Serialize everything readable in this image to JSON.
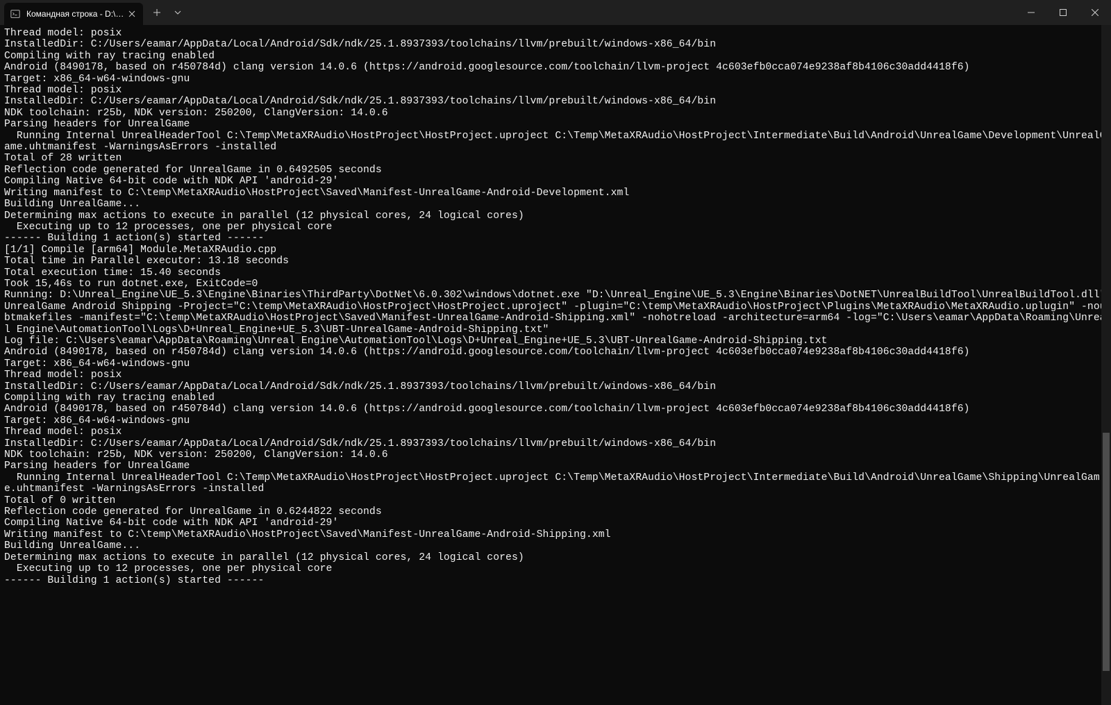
{
  "window": {
    "tab_title": "Командная строка - D:\\Unrea"
  },
  "terminal": {
    "lines": [
      "Thread model: posix",
      "InstalledDir: C:/Users/eamar/AppData/Local/Android/Sdk/ndk/25.1.8937393/toolchains/llvm/prebuilt/windows-x86_64/bin",
      "Compiling with ray tracing enabled",
      "Android (8490178, based on r450784d) clang version 14.0.6 (https://android.googlesource.com/toolchain/llvm-project 4c603efb0cca074e9238af8b4106c30add4418f6)",
      "Target: x86_64-w64-windows-gnu",
      "Thread model: posix",
      "InstalledDir: C:/Users/eamar/AppData/Local/Android/Sdk/ndk/25.1.8937393/toolchains/llvm/prebuilt/windows-x86_64/bin",
      "NDK toolchain: r25b, NDK version: 250200, ClangVersion: 14.0.6",
      "Parsing headers for UnrealGame",
      "  Running Internal UnrealHeaderTool C:\\Temp\\MetaXRAudio\\HostProject\\HostProject.uproject C:\\Temp\\MetaXRAudio\\HostProject\\Intermediate\\Build\\Android\\UnrealGame\\Development\\UnrealGame.uhtmanifest -WarningsAsErrors -installed",
      "Total of 28 written",
      "Reflection code generated for UnrealGame in 0.6492505 seconds",
      "Compiling Native 64-bit code with NDK API 'android-29'",
      "Writing manifest to C:\\temp\\MetaXRAudio\\HostProject\\Saved\\Manifest-UnrealGame-Android-Development.xml",
      "Building UnrealGame...",
      "Determining max actions to execute in parallel (12 physical cores, 24 logical cores)",
      "  Executing up to 12 processes, one per physical core",
      "------ Building 1 action(s) started ------",
      "[1/1] Compile [arm64] Module.MetaXRAudio.cpp",
      "Total time in Parallel executor: 13.18 seconds",
      "Total execution time: 15.40 seconds",
      "Took 15,46s to run dotnet.exe, ExitCode=0",
      "Running: D:\\Unreal_Engine\\UE_5.3\\Engine\\Binaries\\ThirdParty\\DotNet\\6.0.302\\windows\\dotnet.exe \"D:\\Unreal_Engine\\UE_5.3\\Engine\\Binaries\\DotNET\\UnrealBuildTool\\UnrealBuildTool.dll\" UnrealGame Android Shipping -Project=\"C:\\temp\\MetaXRAudio\\HostProject\\HostProject.uproject\" -plugin=\"C:\\temp\\MetaXRAudio\\HostProject\\Plugins\\MetaXRAudio\\MetaXRAudio.uplugin\" -noubtmakefiles -manifest=\"C:\\temp\\MetaXRAudio\\HostProject\\Saved\\Manifest-UnrealGame-Android-Shipping.xml\" -nohotreload -architecture=arm64 -log=\"C:\\Users\\eamar\\AppData\\Roaming\\Unreal Engine\\AutomationTool\\Logs\\D+Unreal_Engine+UE_5.3\\UBT-UnrealGame-Android-Shipping.txt\"",
      "Log file: C:\\Users\\eamar\\AppData\\Roaming\\Unreal Engine\\AutomationTool\\Logs\\D+Unreal_Engine+UE_5.3\\UBT-UnrealGame-Android-Shipping.txt",
      "Android (8490178, based on r450784d) clang version 14.0.6 (https://android.googlesource.com/toolchain/llvm-project 4c603efb0cca074e9238af8b4106c30add4418f6)",
      "Target: x86_64-w64-windows-gnu",
      "Thread model: posix",
      "InstalledDir: C:/Users/eamar/AppData/Local/Android/Sdk/ndk/25.1.8937393/toolchains/llvm/prebuilt/windows-x86_64/bin",
      "Compiling with ray tracing enabled",
      "Android (8490178, based on r450784d) clang version 14.0.6 (https://android.googlesource.com/toolchain/llvm-project 4c603efb0cca074e9238af8b4106c30add4418f6)",
      "Target: x86_64-w64-windows-gnu",
      "Thread model: posix",
      "InstalledDir: C:/Users/eamar/AppData/Local/Android/Sdk/ndk/25.1.8937393/toolchains/llvm/prebuilt/windows-x86_64/bin",
      "NDK toolchain: r25b, NDK version: 250200, ClangVersion: 14.0.6",
      "Parsing headers for UnrealGame",
      "  Running Internal UnrealHeaderTool C:\\Temp\\MetaXRAudio\\HostProject\\HostProject.uproject C:\\Temp\\MetaXRAudio\\HostProject\\Intermediate\\Build\\Android\\UnrealGame\\Shipping\\UnrealGame.uhtmanifest -WarningsAsErrors -installed",
      "Total of 0 written",
      "Reflection code generated for UnrealGame in 0.6244822 seconds",
      "Compiling Native 64-bit code with NDK API 'android-29'",
      "Writing manifest to C:\\temp\\MetaXRAudio\\HostProject\\Saved\\Manifest-UnrealGame-Android-Shipping.xml",
      "Building UnrealGame...",
      "Determining max actions to execute in parallel (12 physical cores, 24 logical cores)",
      "  Executing up to 12 processes, one per physical core",
      "------ Building 1 action(s) started ------"
    ]
  }
}
